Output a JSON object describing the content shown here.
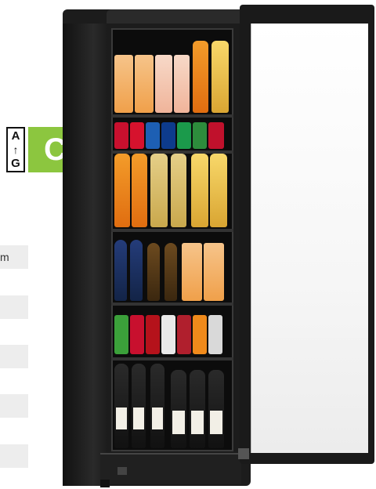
{
  "energy_label": {
    "scale_top": "A",
    "scale_bottom": "G",
    "class": "C",
    "class_color": "#8cc63f"
  },
  "spec_rows": [
    {
      "text": "m"
    },
    {
      "text": ""
    },
    {
      "text": ""
    },
    {
      "text": ""
    },
    {
      "text": ""
    }
  ]
}
